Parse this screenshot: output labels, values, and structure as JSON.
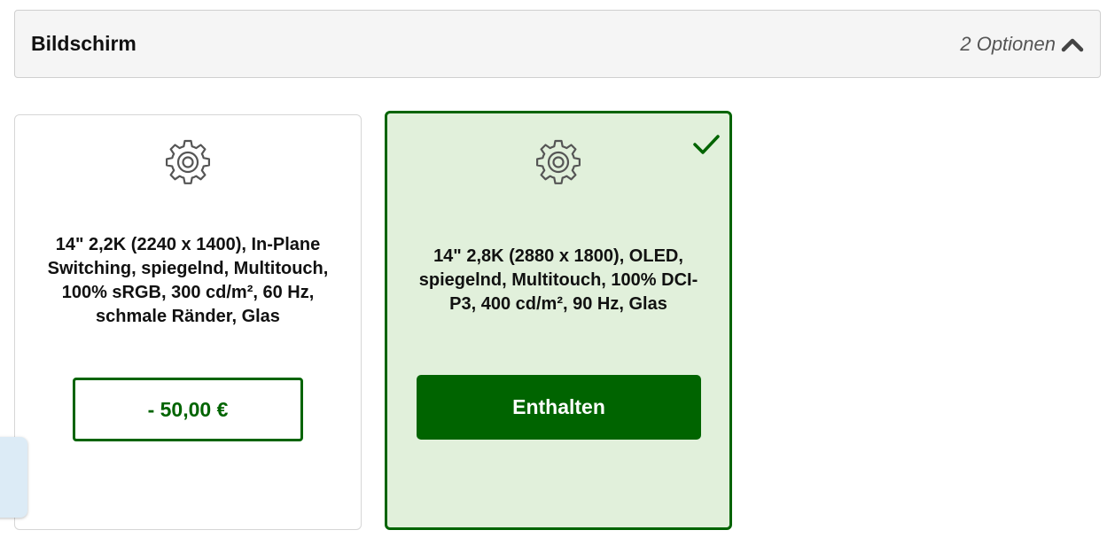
{
  "section": {
    "title": "Bildschirm",
    "option_count": "2 Optionen",
    "toggle_icon": "chevron-up-icon"
  },
  "options": [
    {
      "icon": "gear-icon",
      "description": "14\" 2,2K (2240 x 1400), In-Plane Switching, spiegelnd, Multitouch, 100% sRGB, 300 cd/m², 60 Hz, schmale Ränder, Glas",
      "button_label": "- 50,00 €",
      "selected": false
    },
    {
      "icon": "gear-icon",
      "description": "14\" 2,8K (2880 x 1800), OLED, spiegelnd, Multitouch, 100% DCI-P3, 400 cd/m², 90 Hz, Glas",
      "button_label": "Enthalten",
      "selected": true,
      "selected_icon": "checkmark-icon"
    }
  ],
  "colors": {
    "accent_green": "#006400",
    "selected_background": "#e1f0db",
    "header_background": "#f5f5f5",
    "side_tab": "#dcebf6"
  }
}
